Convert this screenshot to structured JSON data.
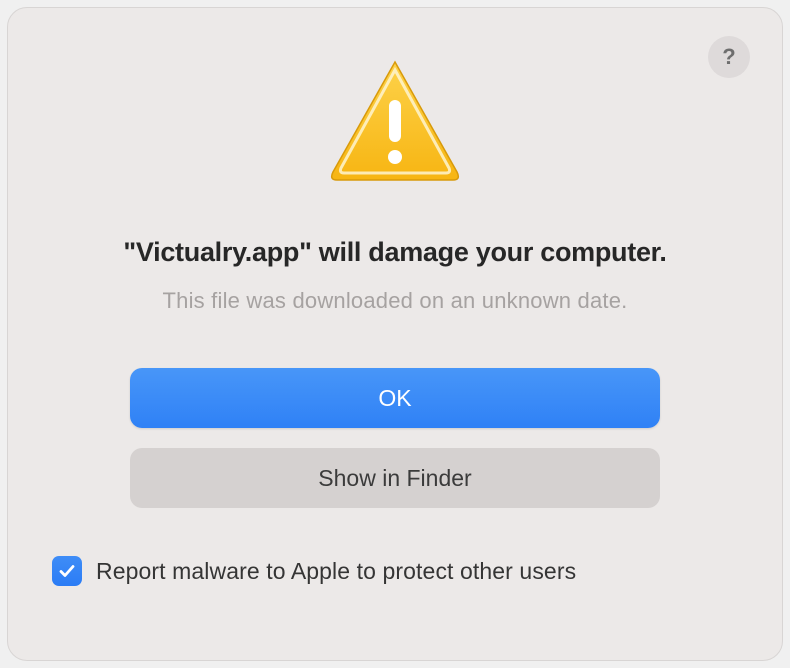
{
  "dialog": {
    "title": "\"Victualry.app\" will damage your computer.",
    "message": "This file was downloaded on an unknown date.",
    "help_label": "?",
    "buttons": {
      "primary": "OK",
      "secondary": "Show in Finder"
    },
    "checkbox": {
      "checked": true,
      "label": "Report malware to Apple to protect other users"
    }
  },
  "icons": {
    "warning": "warning-triangle",
    "help": "question-mark",
    "check": "checkmark"
  },
  "colors": {
    "primary_button": "#3585f7",
    "secondary_button": "#d5d1d0",
    "checkbox": "#3084f6",
    "dialog_bg": "#ece9e8"
  }
}
